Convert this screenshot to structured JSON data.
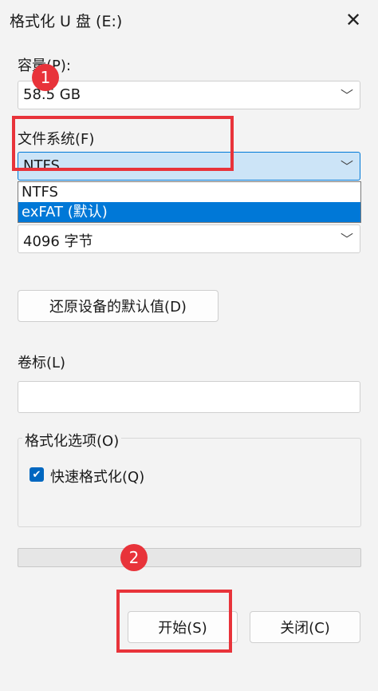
{
  "window": {
    "title": "格式化 U 盘 (E:)"
  },
  "capacity": {
    "label": "容量(P):",
    "value": "58.5 GB"
  },
  "filesystem": {
    "label": "文件系统(F)",
    "value": "NTFS",
    "options": [
      "NTFS",
      "exFAT (默认)"
    ],
    "highlighted": "exFAT (默认)"
  },
  "allocation": {
    "value": "4096 字节"
  },
  "restore_button": "还原设备的默认值(D)",
  "volume_label": {
    "label": "卷标(L)",
    "value": ""
  },
  "format_options": {
    "title": "格式化选项(O)",
    "quick_format_label": "快速格式化(Q)",
    "quick_format_checked": true
  },
  "progress": {
    "value": 0
  },
  "buttons": {
    "start": "开始(S)",
    "close": "关闭(C)"
  },
  "annotations": {
    "badge1": "1",
    "badge2": "2"
  },
  "colors": {
    "accent": "#0078d7",
    "annotation_red": "#e8333a"
  }
}
